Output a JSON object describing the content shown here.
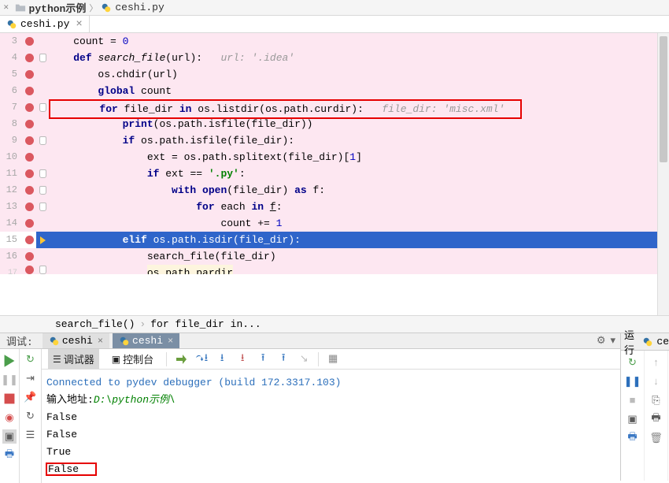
{
  "breadcrumb": {
    "dir": "python示例",
    "file": "ceshi.py",
    "sep": "〉"
  },
  "tabs": [
    {
      "name": "ceshi.py"
    }
  ],
  "code": {
    "lines": [
      {
        "n": 3,
        "bp": true,
        "mkr": "",
        "ind": 1,
        "frags": [
          {
            "t": "count = "
          },
          {
            "t": "0",
            "c": "num"
          }
        ]
      },
      {
        "n": 4,
        "bp": true,
        "mkr": "shield",
        "ind": 1,
        "frags": [
          {
            "t": "def ",
            "c": "kw"
          },
          {
            "t": "search_file",
            "c": "fn"
          },
          {
            "t": "(url):   "
          },
          {
            "t": "url: '.idea'",
            "c": "cmt"
          }
        ]
      },
      {
        "n": 5,
        "bp": true,
        "mkr": "",
        "ind": 2,
        "frags": [
          {
            "t": "os.chdir(url)"
          }
        ]
      },
      {
        "n": 6,
        "bp": true,
        "mkr": "",
        "ind": 2,
        "frags": [
          {
            "t": "global ",
            "c": "kw"
          },
          {
            "t": "count"
          }
        ]
      },
      {
        "n": 7,
        "bp": true,
        "mkr": "shield",
        "ind": 2,
        "box": true,
        "frags": [
          {
            "t": "for ",
            "c": "kw"
          },
          {
            "t": "file_dir "
          },
          {
            "t": "in ",
            "c": "kw"
          },
          {
            "t": "os.listdir(os.path.curdir):   "
          },
          {
            "t": "file_dir: 'misc.xml'",
            "c": "cmt"
          }
        ]
      },
      {
        "n": 8,
        "bp": true,
        "mkr": "",
        "ind": 3,
        "frags": [
          {
            "t": "print",
            "c": "kw2"
          },
          {
            "t": "(os.path.isfile(file_dir))"
          }
        ]
      },
      {
        "n": 9,
        "bp": true,
        "mkr": "shield",
        "ind": 3,
        "frags": [
          {
            "t": "if ",
            "c": "kw"
          },
          {
            "t": "os.path.isfile(file_dir):"
          }
        ]
      },
      {
        "n": 10,
        "bp": true,
        "mkr": "",
        "ind": 4,
        "frags": [
          {
            "t": "ext = os.path.splitext(file_dir)["
          },
          {
            "t": "1",
            "c": "num"
          },
          {
            "t": "]"
          }
        ]
      },
      {
        "n": 11,
        "bp": true,
        "mkr": "shield",
        "ind": 4,
        "frags": [
          {
            "t": "if ",
            "c": "kw"
          },
          {
            "t": "ext == "
          },
          {
            "t": "'.py'",
            "c": "str"
          },
          {
            "t": ":"
          }
        ]
      },
      {
        "n": 12,
        "bp": true,
        "mkr": "shield",
        "ind": 5,
        "frags": [
          {
            "t": "with ",
            "c": "kw"
          },
          {
            "t": "open",
            "c": "kw2"
          },
          {
            "t": "(file_dir) "
          },
          {
            "t": "as ",
            "c": "kw"
          },
          {
            "t": "f:"
          }
        ]
      },
      {
        "n": 13,
        "bp": true,
        "mkr": "shield",
        "ind": 6,
        "frags": [
          {
            "t": "for ",
            "c": "kw"
          },
          {
            "t": "each "
          },
          {
            "t": "in ",
            "c": "kw"
          },
          {
            "t": "f",
            "c": "underline"
          },
          {
            "t": ":"
          }
        ]
      },
      {
        "n": 14,
        "bp": true,
        "mkr": "",
        "ind": 7,
        "frags": [
          {
            "t": "count += "
          },
          {
            "t": "1",
            "c": "num"
          }
        ]
      },
      {
        "n": 15,
        "bp": true,
        "mkr": "arrow",
        "ind": 3,
        "sel": true,
        "frags": [
          {
            "t": "elif ",
            "c": "kw"
          },
          {
            "t": "os.path.isdir(file_dir):"
          }
        ]
      },
      {
        "n": 16,
        "bp": true,
        "mkr": "",
        "ind": 4,
        "frags": [
          {
            "t": "search_file(file_dir)"
          }
        ]
      },
      {
        "n": 17,
        "bp": true,
        "mkr": "shield",
        "ind": 4,
        "cutoff": true,
        "frags": [
          {
            "t": "os.path.pardir",
            "c": "",
            "pale": true
          }
        ]
      }
    ]
  },
  "nav": {
    "fn": "search_file()",
    "stmt": "for file_dir in..."
  },
  "debug": {
    "label": "调试:",
    "tabs": [
      {
        "name": "ceshi",
        "active": false
      },
      {
        "name": "ceshi",
        "active": true
      }
    ],
    "subTabs": {
      "a": "调试器",
      "b": "控制台"
    },
    "run_label": "运行",
    "run_conf": "ce"
  },
  "console": {
    "built": "Connected to pydev debugger (build 172.3317.103)",
    "prompt": "输入地址:",
    "path": "D:\\python示例\\",
    "out": [
      "False",
      "False",
      "True",
      "False"
    ]
  }
}
